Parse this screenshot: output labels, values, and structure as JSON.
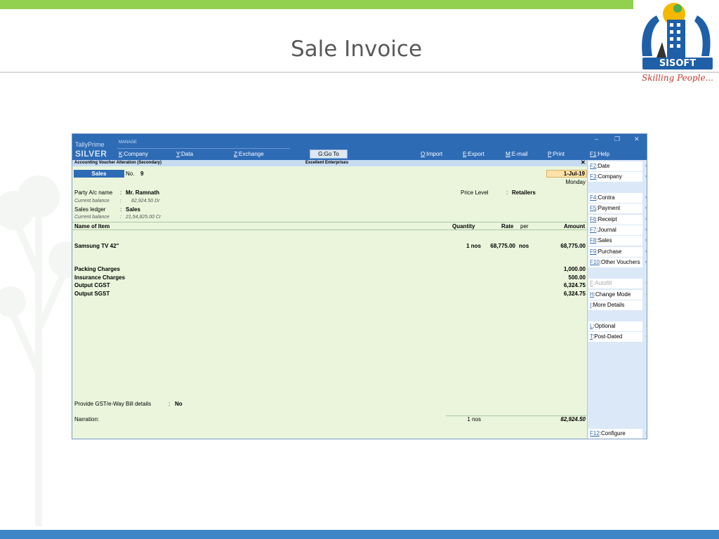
{
  "slide": {
    "title": "Sale Invoice",
    "logo_text": "SISOFT",
    "logo_tagline": "Skilling People..."
  },
  "tally": {
    "brand_line1": "TallyPrime",
    "brand_line2": "SILVER",
    "manage_label": "MANAGE",
    "menu": [
      {
        "key": "K",
        "label": "Company"
      },
      {
        "key": "Y",
        "label": "Data"
      },
      {
        "key": "Z",
        "label": "Exchange"
      },
      {
        "key": "G",
        "label": "Go To"
      },
      {
        "key": "O",
        "label": "Import"
      },
      {
        "key": "E",
        "label": "Export"
      },
      {
        "key": "M",
        "label": "E-mail"
      },
      {
        "key": "P",
        "label": "Print"
      },
      {
        "key": "F1",
        "label": "Help"
      }
    ],
    "window_controls": {
      "minimize": "–",
      "restore": "❐",
      "close": "✕"
    },
    "subheader": {
      "left": "Accounting Voucher Alteration (Secondary)",
      "center": "Excellent Enterprises",
      "close": "✕"
    },
    "voucher": {
      "type": "Sales",
      "no_label": "No.",
      "no_value": "9",
      "date": "1-Jul-19",
      "day": "Monday",
      "party_label": "Party A/c name",
      "party_value": "Mr. Ramnath",
      "party_balance_label": "Current balance",
      "party_balance_value": "82,924.50 Dr",
      "ledger_label": "Sales ledger",
      "ledger_value": "Sales",
      "ledger_balance_label": "Current balance",
      "ledger_balance_value": "21,54,825.00 Cr",
      "price_level_label": "Price Level",
      "price_level_value": "Retailers",
      "sep": ":"
    },
    "columns": {
      "item": "Name of Item",
      "quantity": "Quantity",
      "rate": "Rate",
      "per": "per",
      "amount": "Amount"
    },
    "items": [
      {
        "name": "Samsung TV 42\"",
        "quantity": "1 nos",
        "rate": "68,775.00",
        "per": "nos",
        "amount": "68,775.00"
      }
    ],
    "charges": [
      {
        "name": "Packing Charges",
        "amount": "1,000.00"
      },
      {
        "name": "Insurance Charges",
        "amount": "500.00"
      },
      {
        "name": "Output CGST",
        "amount": "6,324.75"
      },
      {
        "name": "Output SGST",
        "amount": "6,324.75"
      }
    ],
    "gst_label": "Provide GST/e-Way Bill details",
    "gst_value": "No",
    "narration_label": "Narration:",
    "total_quantity": "1 nos",
    "total_amount": "82,924.50",
    "side_buttons": [
      {
        "key": "F2",
        "label": "Date",
        "arrow": "‹"
      },
      {
        "key": "F3",
        "label": "Company",
        "arrow": "‹"
      },
      {
        "key": "F4",
        "label": "Contra",
        "arrow": "‹"
      },
      {
        "key": "F5",
        "label": "Payment",
        "arrow": "‹"
      },
      {
        "key": "F6",
        "label": "Receipt",
        "arrow": "‹"
      },
      {
        "key": "F7",
        "label": "Journal",
        "arrow": "‹"
      },
      {
        "key": "F8",
        "label": "Sales",
        "arrow": "‹"
      },
      {
        "key": "F9",
        "label": "Purchase",
        "arrow": "‹"
      },
      {
        "key": "F10",
        "label": "Other Vouchers",
        "arrow": "‹"
      },
      {
        "key": "F",
        "label": "Autofill",
        "arrow": "‹"
      },
      {
        "key": "H",
        "label": "Change Mode",
        "arrow": "‹"
      },
      {
        "key": "I",
        "label": "More Details",
        "arrow": "‹"
      },
      {
        "key": "L",
        "label": "Optional",
        "arrow": "‹"
      },
      {
        "key": "T",
        "label": "Post-Dated",
        "arrow": "‹"
      },
      {
        "key": "F12",
        "label": "Configure",
        "arrow": "‹"
      }
    ]
  }
}
